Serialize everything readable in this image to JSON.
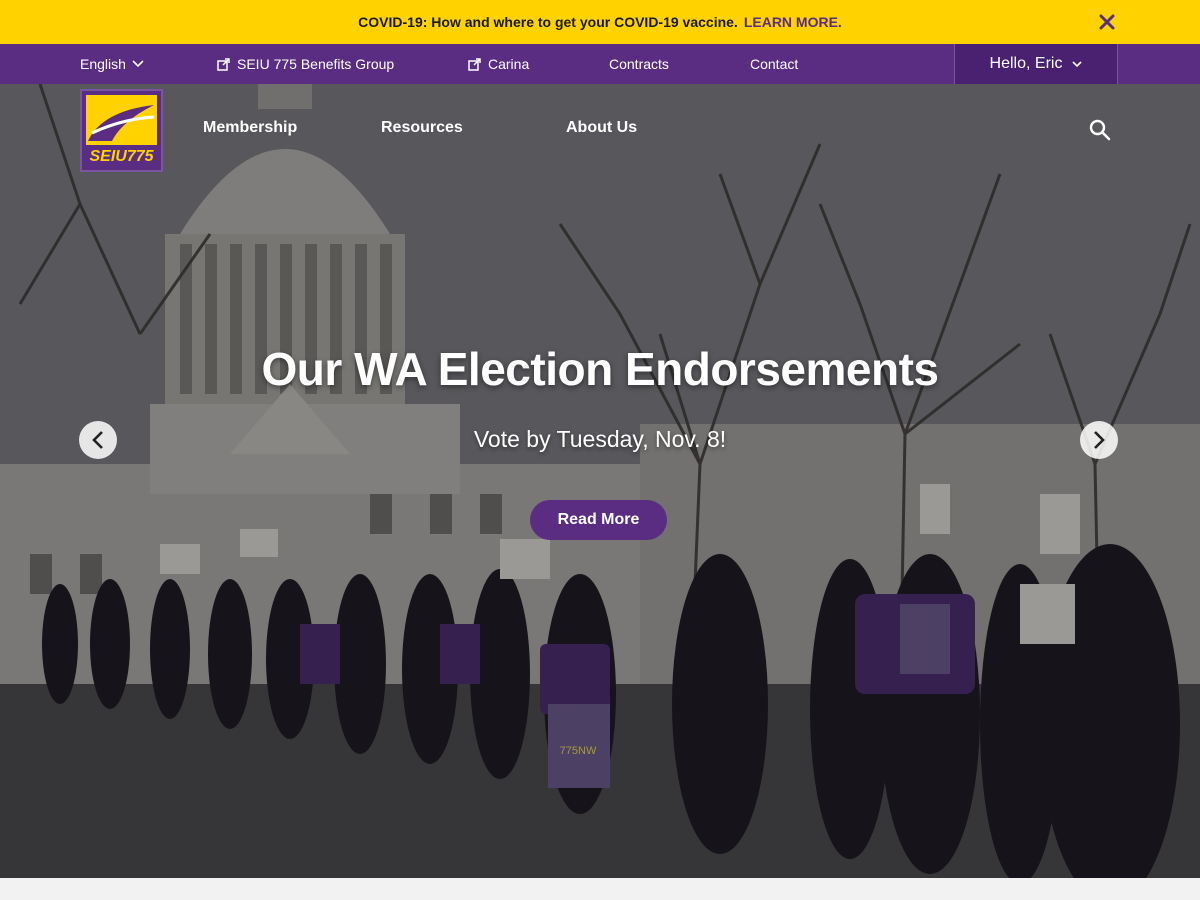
{
  "alert": {
    "message": "COVID-19: How and where to get your COVID-19 vaccine.",
    "link_label": "LEARN MORE.",
    "close_icon": "close-icon",
    "background": "#ffd200",
    "link_color": "#5a2d82"
  },
  "utility_bar": {
    "language": "English",
    "links": [
      {
        "label": "SEIU 775 Benefits Group",
        "icon": "external-link-icon"
      },
      {
        "label": "Carina",
        "icon": "external-link-icon"
      },
      {
        "label": "Contracts"
      },
      {
        "label": "Contact"
      }
    ],
    "greeting": "Hello, Eric",
    "background": "#5a2d82"
  },
  "logo": {
    "text": "SEIU775"
  },
  "main_nav": {
    "items": [
      {
        "label": "Membership"
      },
      {
        "label": "Resources"
      },
      {
        "label": "About Us"
      }
    ],
    "search_icon": "search-icon"
  },
  "hero": {
    "title": "Our WA Election Endorsements",
    "subtitle": "Vote by Tuesday, Nov. 8!",
    "cta_label": "Read More",
    "prev_icon": "chevron-left-icon",
    "next_icon": "chevron-right-icon",
    "sign_text": "775NW"
  }
}
